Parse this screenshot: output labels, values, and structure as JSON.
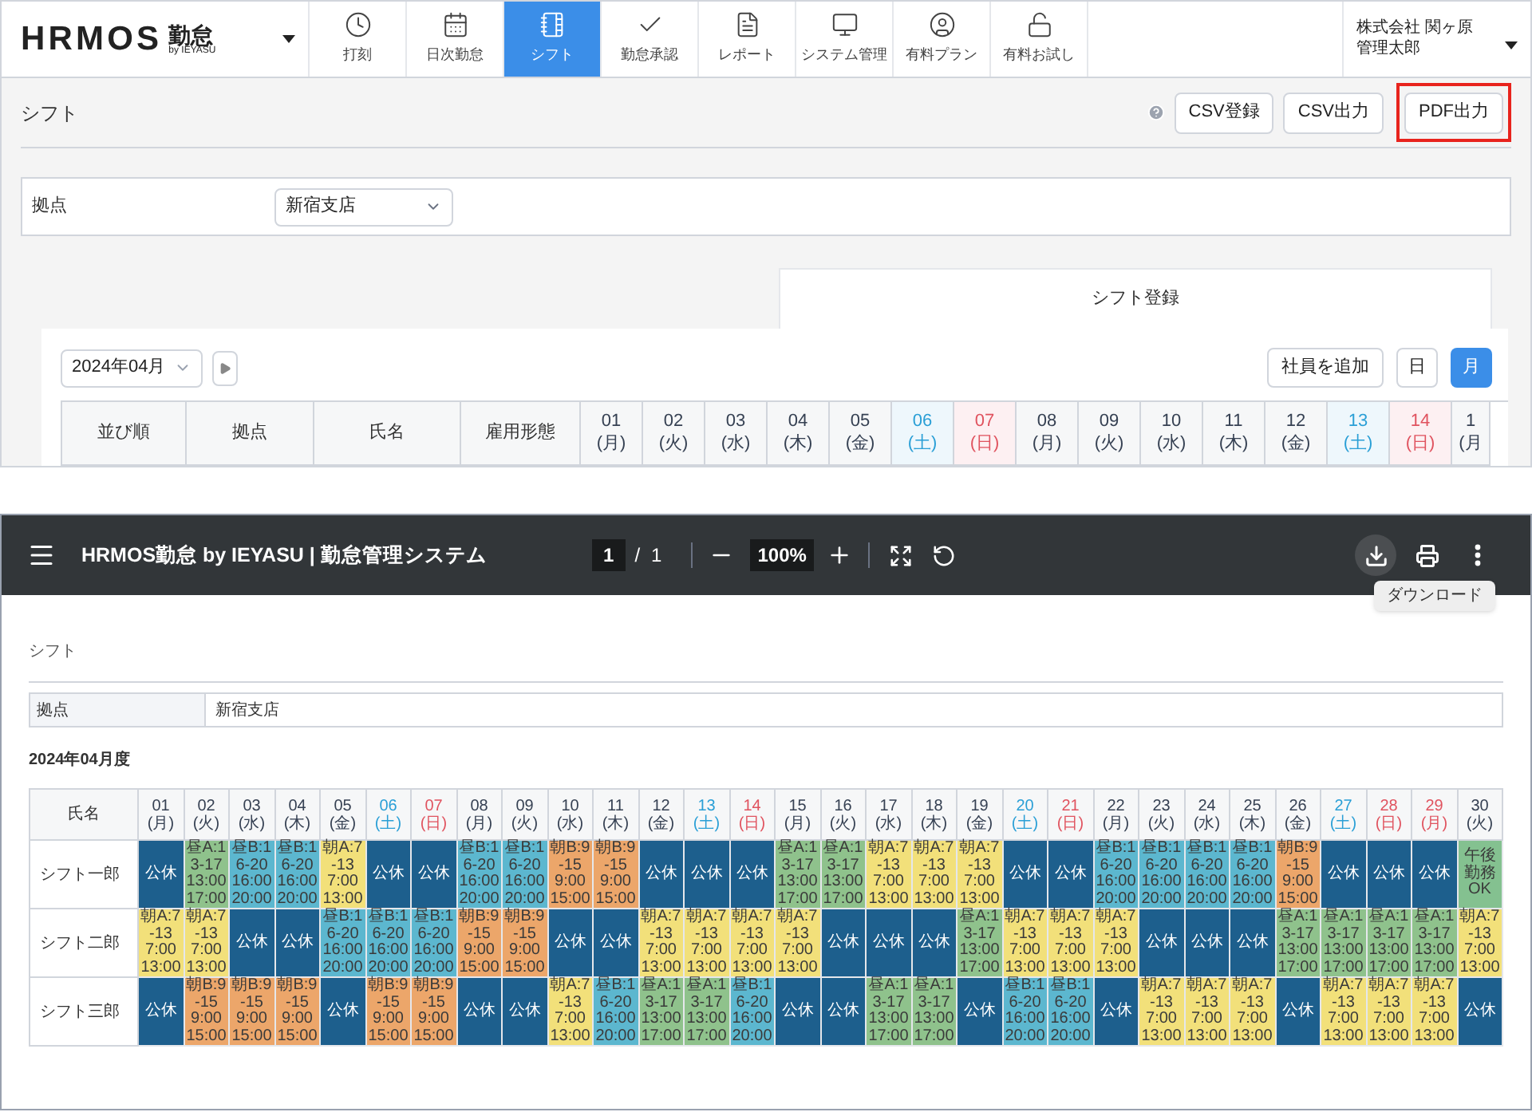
{
  "header": {
    "logo": "HRMOS",
    "logo_suffix": "勤怠",
    "logo_byline": "by IEYASU",
    "nav": [
      {
        "label": "打刻",
        "selected": false
      },
      {
        "label": "日次勤怠",
        "selected": false
      },
      {
        "label": "シフト",
        "selected": true
      },
      {
        "label": "勤怠承認",
        "selected": false
      },
      {
        "label": "レポート",
        "selected": false
      },
      {
        "label": "システム管理",
        "selected": false
      },
      {
        "label": "有料プラン",
        "selected": false
      },
      {
        "label": "有料お試し",
        "selected": false
      }
    ],
    "company": "株式会社 関ヶ原",
    "user": "管理太郎"
  },
  "page": {
    "title": "シフト",
    "buttons": [
      {
        "label": "CSV登録",
        "highlighted": false
      },
      {
        "label": "CSV出力",
        "highlighted": false
      },
      {
        "label": "PDF出力",
        "highlighted": true
      }
    ],
    "filter": {
      "label": "拠点",
      "value": "新宿支店"
    },
    "tabs": [
      {
        "label": "シフト登録",
        "selected": true
      }
    ],
    "month": "2024年04月",
    "add_button": "社員を追加",
    "views": [
      {
        "label": "日",
        "selected": false
      },
      {
        "label": "月",
        "selected": true
      }
    ],
    "columns": [
      "並び順",
      "拠点",
      "氏名",
      "雇用形態"
    ],
    "days": [
      {
        "day": "01",
        "weekday": "(月)",
        "kind": "weekday"
      },
      {
        "day": "02",
        "weekday": "(火)",
        "kind": "weekday"
      },
      {
        "day": "03",
        "weekday": "(水)",
        "kind": "weekday"
      },
      {
        "day": "04",
        "weekday": "(木)",
        "kind": "weekday"
      },
      {
        "day": "05",
        "weekday": "(金)",
        "kind": "weekday"
      },
      {
        "day": "06",
        "weekday": "(土)",
        "kind": "saturday"
      },
      {
        "day": "07",
        "weekday": "(日)",
        "kind": "sunday"
      },
      {
        "day": "08",
        "weekday": "(月)",
        "kind": "weekday"
      },
      {
        "day": "09",
        "weekday": "(火)",
        "kind": "weekday"
      },
      {
        "day": "10",
        "weekday": "(水)",
        "kind": "weekday"
      },
      {
        "day": "11",
        "weekday": "(木)",
        "kind": "weekday"
      },
      {
        "day": "12",
        "weekday": "(金)",
        "kind": "weekday"
      },
      {
        "day": "13",
        "weekday": "(土)",
        "kind": "saturday"
      },
      {
        "day": "14",
        "weekday": "(日)",
        "kind": "sunday"
      },
      {
        "day": "1",
        "weekday": "(月",
        "kind": "weekday"
      }
    ]
  },
  "pdf_viewer": {
    "title": "HRMOS勤怠 by IEYASU | 勤怠管理システム",
    "page": "1",
    "separator": "/",
    "page_count": "1",
    "zoom": "100%",
    "tools": [
      {
        "active": true
      },
      {
        "active": false
      },
      {
        "active": false
      }
    ],
    "tooltip": "ダウンロード",
    "document": {
      "title": "シフト",
      "filter_label": "拠点",
      "filter_value": "新宿支店",
      "period": "2024年04月度",
      "name_header": "氏名",
      "days": [
        {
          "day": "01",
          "weekday": "(月)",
          "kind": "weekday"
        },
        {
          "day": "02",
          "weekday": "(火)",
          "kind": "weekday"
        },
        {
          "day": "03",
          "weekday": "(水)",
          "kind": "weekday"
        },
        {
          "day": "04",
          "weekday": "(木)",
          "kind": "weekday"
        },
        {
          "day": "05",
          "weekday": "(金)",
          "kind": "weekday"
        },
        {
          "day": "06",
          "weekday": "(土)",
          "kind": "saturday"
        },
        {
          "day": "07",
          "weekday": "(日)",
          "kind": "sunday"
        },
        {
          "day": "08",
          "weekday": "(月)",
          "kind": "weekday"
        },
        {
          "day": "09",
          "weekday": "(火)",
          "kind": "weekday"
        },
        {
          "day": "10",
          "weekday": "(水)",
          "kind": "weekday"
        },
        {
          "day": "11",
          "weekday": "(木)",
          "kind": "weekday"
        },
        {
          "day": "12",
          "weekday": "(金)",
          "kind": "weekday"
        },
        {
          "day": "13",
          "weekday": "(土)",
          "kind": "saturday"
        },
        {
          "day": "14",
          "weekday": "(日)",
          "kind": "sunday"
        },
        {
          "day": "15",
          "weekday": "(月)",
          "kind": "weekday"
        },
        {
          "day": "16",
          "weekday": "(火)",
          "kind": "weekday"
        },
        {
          "day": "17",
          "weekday": "(水)",
          "kind": "weekday"
        },
        {
          "day": "18",
          "weekday": "(木)",
          "kind": "weekday"
        },
        {
          "day": "19",
          "weekday": "(金)",
          "kind": "weekday"
        },
        {
          "day": "20",
          "weekday": "(土)",
          "kind": "saturday"
        },
        {
          "day": "21",
          "weekday": "(日)",
          "kind": "sunday"
        },
        {
          "day": "22",
          "weekday": "(月)",
          "kind": "weekday"
        },
        {
          "day": "23",
          "weekday": "(火)",
          "kind": "weekday"
        },
        {
          "day": "24",
          "weekday": "(水)",
          "kind": "weekday"
        },
        {
          "day": "25",
          "weekday": "(木)",
          "kind": "weekday"
        },
        {
          "day": "26",
          "weekday": "(金)",
          "kind": "weekday"
        },
        {
          "day": "27",
          "weekday": "(土)",
          "kind": "saturday"
        },
        {
          "day": "28",
          "weekday": "(日)",
          "kind": "sunday"
        },
        {
          "day": "29",
          "weekday": "(月)",
          "kind": "holiday"
        },
        {
          "day": "30",
          "weekday": "(火)",
          "kind": "weekday"
        }
      ],
      "rows": [
        {
          "name": "シフト一郎",
          "cells": [
            {
              "kind": "off",
              "label": "公休"
            },
            {
              "kind": "hiru_a",
              "label": "昼A:13-17",
              "start": "13:00",
              "end": "17:00"
            },
            {
              "kind": "hiru_b",
              "label": "昼B:16-20",
              "start": "16:00",
              "end": "20:00"
            },
            {
              "kind": "hiru_b",
              "label": "昼B:16-20",
              "start": "16:00",
              "end": "20:00"
            },
            {
              "kind": "asa_a",
              "label": "朝A:7-13",
              "start": "7:00",
              "end": "13:00"
            },
            {
              "kind": "off",
              "label": "公休"
            },
            {
              "kind": "off",
              "label": "公休"
            },
            {
              "kind": "hiru_b",
              "label": "昼B:16-20",
              "start": "16:00",
              "end": "20:00"
            },
            {
              "kind": "hiru_b",
              "label": "昼B:16-20",
              "start": "16:00",
              "end": "20:00"
            },
            {
              "kind": "asa_b",
              "label": "朝B:9-15",
              "start": "9:00",
              "end": "15:00"
            },
            {
              "kind": "asa_b",
              "label": "朝B:9-15",
              "start": "9:00",
              "end": "15:00"
            },
            {
              "kind": "off",
              "label": "公休"
            },
            {
              "kind": "off",
              "label": "公休"
            },
            {
              "kind": "off",
              "label": "公休"
            },
            {
              "kind": "hiru_a",
              "label": "昼A:13-17",
              "start": "13:00",
              "end": "17:00"
            },
            {
              "kind": "hiru_a",
              "label": "昼A:13-17",
              "start": "13:00",
              "end": "17:00"
            },
            {
              "kind": "asa_a",
              "label": "朝A:7-13",
              "start": "7:00",
              "end": "13:00"
            },
            {
              "kind": "asa_a",
              "label": "朝A:7-13",
              "start": "7:00",
              "end": "13:00"
            },
            {
              "kind": "asa_a",
              "label": "朝A:7-13",
              "start": "7:00",
              "end": "13:00"
            },
            {
              "kind": "off",
              "label": "公休"
            },
            {
              "kind": "off",
              "label": "公休"
            },
            {
              "kind": "hiru_b",
              "label": "昼B:16-20",
              "start": "16:00",
              "end": "20:00"
            },
            {
              "kind": "hiru_b",
              "label": "昼B:16-20",
              "start": "16:00",
              "end": "20:00"
            },
            {
              "kind": "hiru_b",
              "label": "昼B:16-20",
              "start": "16:00",
              "end": "20:00"
            },
            {
              "kind": "hiru_b",
              "label": "昼B:16-20",
              "start": "16:00",
              "end": "20:00"
            },
            {
              "kind": "asa_b",
              "label": "朝B:9-15",
              "start": "9:00",
              "end": "15:00"
            },
            {
              "kind": "off",
              "label": "公休"
            },
            {
              "kind": "off",
              "label": "公休"
            },
            {
              "kind": "off",
              "label": "公休"
            },
            {
              "kind": "note",
              "label": "午後勤務OK"
            }
          ]
        },
        {
          "name": "シフト二郎",
          "cells": [
            {
              "kind": "asa_a",
              "label": "朝A:7-13",
              "start": "7:00",
              "end": "13:00"
            },
            {
              "kind": "asa_a",
              "label": "朝A:7-13",
              "start": "7:00",
              "end": "13:00"
            },
            {
              "kind": "off",
              "label": "公休"
            },
            {
              "kind": "off",
              "label": "公休"
            },
            {
              "kind": "hiru_b",
              "label": "昼B:16-20",
              "start": "16:00",
              "end": "20:00"
            },
            {
              "kind": "hiru_b",
              "label": "昼B:16-20",
              "start": "16:00",
              "end": "20:00"
            },
            {
              "kind": "hiru_b",
              "label": "昼B:16-20",
              "start": "16:00",
              "end": "20:00"
            },
            {
              "kind": "asa_b",
              "label": "朝B:9-15",
              "start": "9:00",
              "end": "15:00"
            },
            {
              "kind": "asa_b",
              "label": "朝B:9-15",
              "start": "9:00",
              "end": "15:00"
            },
            {
              "kind": "off",
              "label": "公休"
            },
            {
              "kind": "off",
              "label": "公休"
            },
            {
              "kind": "asa_a",
              "label": "朝A:7-13",
              "start": "7:00",
              "end": "13:00"
            },
            {
              "kind": "asa_a",
              "label": "朝A:7-13",
              "start": "7:00",
              "end": "13:00"
            },
            {
              "kind": "asa_a",
              "label": "朝A:7-13",
              "start": "7:00",
              "end": "13:00"
            },
            {
              "kind": "asa_a",
              "label": "朝A:7-13",
              "start": "7:00",
              "end": "13:00"
            },
            {
              "kind": "off",
              "label": "公休"
            },
            {
              "kind": "off",
              "label": "公休"
            },
            {
              "kind": "off",
              "label": "公休"
            },
            {
              "kind": "hiru_a",
              "label": "昼A:13-17",
              "start": "13:00",
              "end": "17:00"
            },
            {
              "kind": "asa_a",
              "label": "朝A:7-13",
              "start": "7:00",
              "end": "13:00"
            },
            {
              "kind": "asa_a",
              "label": "朝A:7-13",
              "start": "7:00",
              "end": "13:00"
            },
            {
              "kind": "asa_a",
              "label": "朝A:7-13",
              "start": "7:00",
              "end": "13:00"
            },
            {
              "kind": "off",
              "label": "公休"
            },
            {
              "kind": "off",
              "label": "公休"
            },
            {
              "kind": "off",
              "label": "公休"
            },
            {
              "kind": "hiru_a",
              "label": "昼A:13-17",
              "start": "13:00",
              "end": "17:00"
            },
            {
              "kind": "hiru_a",
              "label": "昼A:13-17",
              "start": "13:00",
              "end": "17:00"
            },
            {
              "kind": "hiru_a",
              "label": "昼A:13-17",
              "start": "13:00",
              "end": "17:00"
            },
            {
              "kind": "hiru_a",
              "label": "昼A:13-17",
              "start": "13:00",
              "end": "17:00"
            },
            {
              "kind": "asa_a",
              "label": "朝A:7-13",
              "start": "7:00",
              "end": "13:00"
            }
          ]
        },
        {
          "name": "シフト三郎",
          "cells": [
            {
              "kind": "off",
              "label": "公休"
            },
            {
              "kind": "asa_b",
              "label": "朝B:9-15",
              "start": "9:00",
              "end": "15:00"
            },
            {
              "kind": "asa_b",
              "label": "朝B:9-15",
              "start": "9:00",
              "end": "15:00"
            },
            {
              "kind": "asa_b",
              "label": "朝B:9-15",
              "start": "9:00",
              "end": "15:00"
            },
            {
              "kind": "off",
              "label": "公休"
            },
            {
              "kind": "asa_b",
              "label": "朝B:9-15",
              "start": "9:00",
              "end": "15:00"
            },
            {
              "kind": "asa_b",
              "label": "朝B:9-15",
              "start": "9:00",
              "end": "15:00"
            },
            {
              "kind": "off",
              "label": "公休"
            },
            {
              "kind": "off",
              "label": "公休"
            },
            {
              "kind": "asa_a",
              "label": "朝A:7-13",
              "start": "7:00",
              "end": "13:00"
            },
            {
              "kind": "hiru_b",
              "label": "昼B:16-20",
              "start": "16:00",
              "end": "20:00"
            },
            {
              "kind": "hiru_a",
              "label": "昼A:13-17",
              "start": "13:00",
              "end": "17:00"
            },
            {
              "kind": "hiru_a",
              "label": "昼A:13-17",
              "start": "13:00",
              "end": "17:00"
            },
            {
              "kind": "hiru_b",
              "label": "昼B:16-20",
              "start": "16:00",
              "end": "20:00"
            },
            {
              "kind": "off",
              "label": "公休"
            },
            {
              "kind": "off",
              "label": "公休"
            },
            {
              "kind": "hiru_a",
              "label": "昼A:13-17",
              "start": "13:00",
              "end": "17:00"
            },
            {
              "kind": "hiru_a",
              "label": "昼A:13-17",
              "start": "13:00",
              "end": "17:00"
            },
            {
              "kind": "off",
              "label": "公休"
            },
            {
              "kind": "hiru_b",
              "label": "昼B:16-20",
              "start": "16:00",
              "end": "20:00"
            },
            {
              "kind": "hiru_b",
              "label": "昼B:16-20",
              "start": "16:00",
              "end": "20:00"
            },
            {
              "kind": "off",
              "label": "公休"
            },
            {
              "kind": "asa_a",
              "label": "朝A:7-13",
              "start": "7:00",
              "end": "13:00"
            },
            {
              "kind": "asa_a",
              "label": "朝A:7-13",
              "start": "7:00",
              "end": "13:00"
            },
            {
              "kind": "asa_a",
              "label": "朝A:7-13",
              "start": "7:00",
              "end": "13:00"
            },
            {
              "kind": "off",
              "label": "公休"
            },
            {
              "kind": "asa_a",
              "label": "朝A:7-13",
              "start": "7:00",
              "end": "13:00"
            },
            {
              "kind": "asa_a",
              "label": "朝A:7-13",
              "start": "7:00",
              "end": "13:00"
            },
            {
              "kind": "asa_a",
              "label": "朝A:7-13",
              "start": "7:00",
              "end": "13:00"
            },
            {
              "kind": "off",
              "label": "公休"
            }
          ]
        }
      ]
    }
  }
}
